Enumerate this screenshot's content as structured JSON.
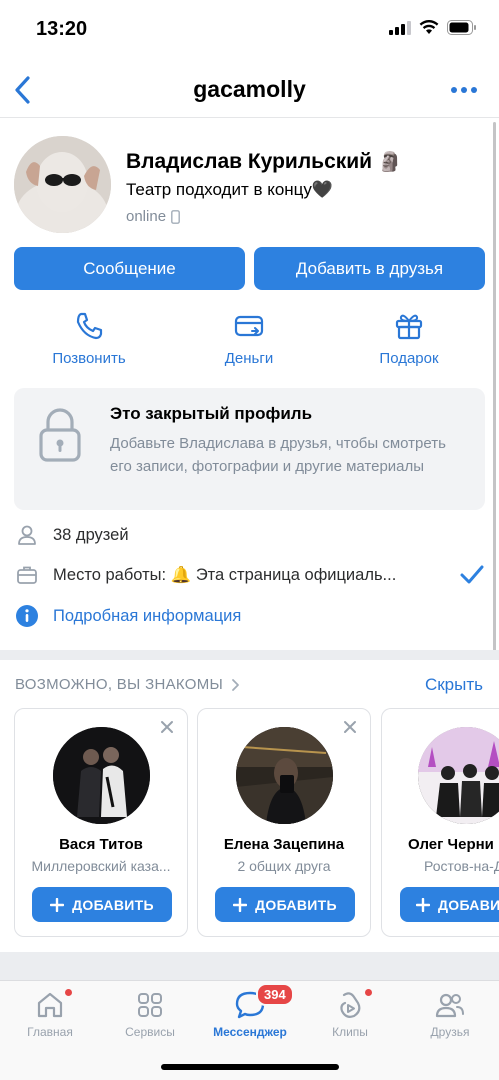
{
  "status_bar": {
    "time": "13:20"
  },
  "nav": {
    "title": "gacamolly"
  },
  "profile": {
    "name": "Владислав Курильский",
    "name_emoji": "🗿",
    "status": "Театр подходит в концу🖤",
    "online": "online",
    "message_button": "Сообщение",
    "add_friend_button": "Добавить в друзья"
  },
  "actions": [
    {
      "label": "Позвонить",
      "icon": "phone-icon"
    },
    {
      "label": "Деньги",
      "icon": "money-icon"
    },
    {
      "label": "Подарок",
      "icon": "gift-icon"
    }
  ],
  "private_profile": {
    "title": "Это закрытый профиль",
    "description": "Добавьте Владислава в друзья, чтобы смотреть его записи, фотографии и другие материалы"
  },
  "info": {
    "friends": "38 друзей",
    "work": "Место работы: 🔔 Эта страница официаль...",
    "details": "Подробная информация"
  },
  "suggestions": {
    "header": "ВОЗМОЖНО, ВЫ ЗНАКОМЫ",
    "hide": "Скрыть",
    "add_label": "ДОБАВИТЬ",
    "people": [
      {
        "name": "Вася Титов",
        "subtitle": "Миллеровский каза..."
      },
      {
        "name": "Елена Зацепина",
        "subtitle": "2 общих друга"
      },
      {
        "name": "Олег Черни",
        "subtitle": "Ростов-на-Д"
      }
    ]
  },
  "tabbar": {
    "items": [
      {
        "label": "Главная",
        "icon": "home-icon"
      },
      {
        "label": "Сервисы",
        "icon": "services-icon"
      },
      {
        "label": "Мессенджер",
        "icon": "messenger-icon",
        "badge": "394"
      },
      {
        "label": "Клипы",
        "icon": "clips-icon"
      },
      {
        "label": "Друзья",
        "icon": "friends-icon"
      }
    ]
  },
  "colors": {
    "accent": "#2d81e0",
    "link": "#2a77d6",
    "secondary": "#818c99",
    "badge": "#e64646"
  }
}
